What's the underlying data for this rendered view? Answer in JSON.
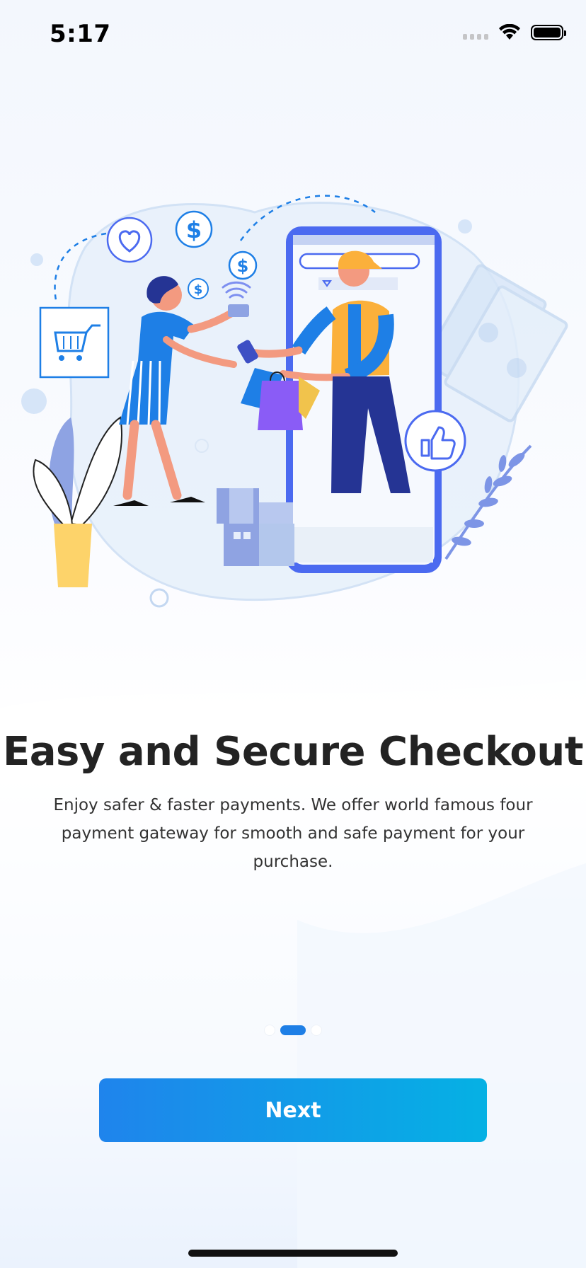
{
  "status_bar": {
    "time": "5:17"
  },
  "onboarding": {
    "title": "Easy and Secure Checkout",
    "description": "Enjoy safer & faster payments. We offer world famous four payment gateway for smooth and safe payment for your purchase.",
    "page_count": 3,
    "current_page": 2,
    "next_label": "Next"
  },
  "colors": {
    "accent": "#1e7fe6",
    "button_gradient_start": "#1f84ec",
    "button_gradient_end": "#05b1e4",
    "title": "#232323"
  },
  "illustration": {
    "icons": [
      "heart-icon",
      "dollar-icon",
      "wifi-icon",
      "cart-icon",
      "credit-card-icon",
      "thumbs-up-icon",
      "shopping-bag-icon"
    ]
  }
}
